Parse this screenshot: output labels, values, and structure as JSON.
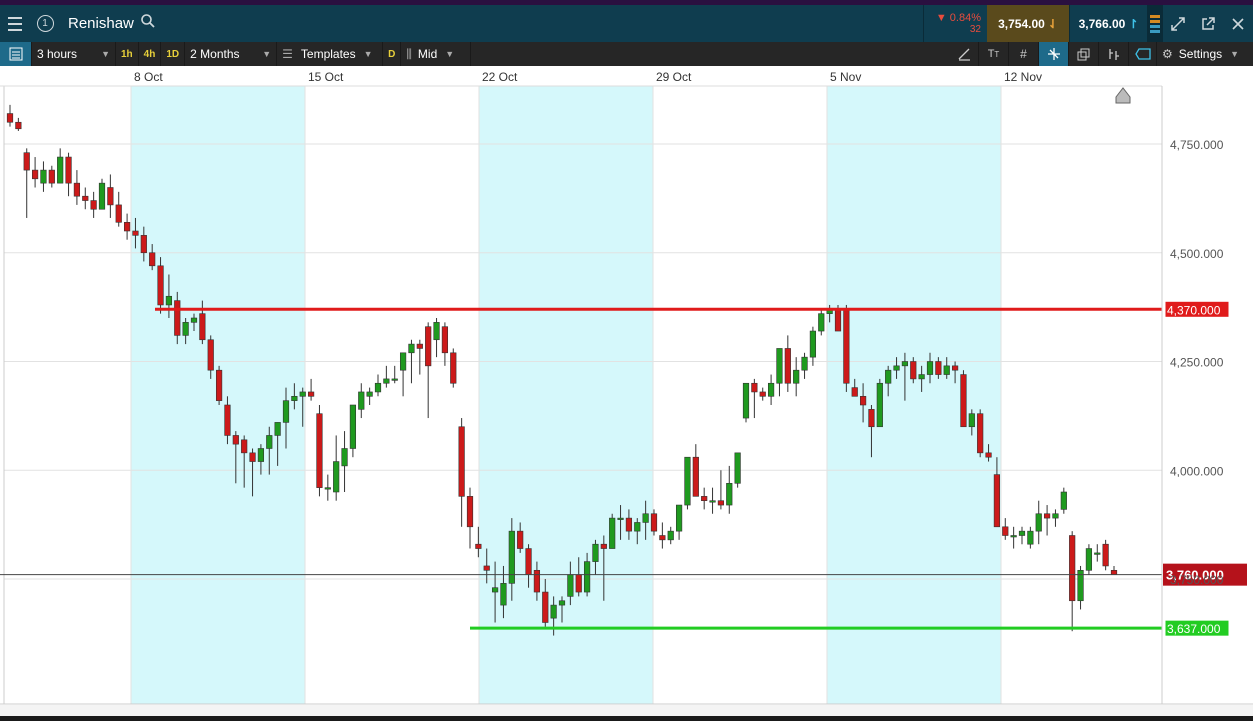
{
  "header": {
    "menu_icon": "hamburger-icon",
    "window_number": "1",
    "title": "Renishaw",
    "change_pct": "0.84%",
    "change_points": "32",
    "sell_price": "3,754.00",
    "buy_price": "3,766.00"
  },
  "toolbar": {
    "interval": "3 hours",
    "tf_1h": "1h",
    "tf_4h": "4h",
    "tf_1d": "1D",
    "range": "2 Months",
    "templates": "Templates",
    "d_badge": "D",
    "price_type": "Mid",
    "settings": "Settings"
  },
  "colors": {
    "up": "#1f9a1f",
    "down": "#cc1a1a",
    "shade": "#d5f8fb",
    "resistance": "#e01b1b",
    "support": "#22cc22"
  },
  "chart_data": {
    "type": "candlestick",
    "x_tick_labels": [
      "8 Oct",
      "15 Oct",
      "22 Oct",
      "29 Oct",
      "5 Nov",
      "12 Nov"
    ],
    "y_tick_labels": [
      "4,750.000",
      "4,500.000",
      "4,250.000",
      "4,000.000",
      "3,750.000"
    ],
    "y_ticks": [
      4750,
      4500,
      4250,
      4000,
      3750
    ],
    "ylim": [
      3500,
      4860
    ],
    "levels": [
      {
        "value": 4370,
        "label": "4,370.000",
        "color": "#e01b1b"
      },
      {
        "value": 3637,
        "label": "3,637.000",
        "color": "#22cc22"
      }
    ],
    "current_price": {
      "value": 3760,
      "label": "3,760.000"
    },
    "candles": [
      [
        4820,
        4840,
        4790,
        4800
      ],
      [
        4800,
        4810,
        4780,
        4785
      ],
      [
        4730,
        4740,
        4580,
        4690
      ],
      [
        4690,
        4720,
        4650,
        4670
      ],
      [
        4660,
        4710,
        4640,
        4690
      ],
      [
        4690,
        4700,
        4650,
        4660
      ],
      [
        4660,
        4740,
        4660,
        4720
      ],
      [
        4720,
        4730,
        4630,
        4660
      ],
      [
        4660,
        4690,
        4610,
        4630
      ],
      [
        4630,
        4650,
        4600,
        4620
      ],
      [
        4620,
        4640,
        4580,
        4600
      ],
      [
        4600,
        4670,
        4600,
        4660
      ],
      [
        4650,
        4680,
        4580,
        4610
      ],
      [
        4610,
        4640,
        4560,
        4570
      ],
      [
        4570,
        4590,
        4530,
        4550
      ],
      [
        4550,
        4580,
        4510,
        4540
      ],
      [
        4540,
        4560,
        4480,
        4500
      ],
      [
        4500,
        4520,
        4460,
        4470
      ],
      [
        4470,
        4490,
        4360,
        4380
      ],
      [
        4380,
        4450,
        4350,
        4400
      ],
      [
        4390,
        4410,
        4290,
        4310
      ],
      [
        4310,
        4350,
        4290,
        4340
      ],
      [
        4340,
        4360,
        4320,
        4350
      ],
      [
        4360,
        4390,
        4290,
        4300
      ],
      [
        4300,
        4310,
        4210,
        4230
      ],
      [
        4230,
        4240,
        4150,
        4160
      ],
      [
        4150,
        4170,
        4060,
        4080
      ],
      [
        4080,
        4090,
        3970,
        4060
      ],
      [
        4070,
        4080,
        3960,
        4040
      ],
      [
        4040,
        4050,
        3940,
        4020
      ],
      [
        4020,
        4060,
        3990,
        4050
      ],
      [
        4050,
        4100,
        3990,
        4080
      ],
      [
        4080,
        4110,
        4010,
        4110
      ],
      [
        4110,
        4190,
        4050,
        4160
      ],
      [
        4160,
        4200,
        4140,
        4170
      ],
      [
        4170,
        4190,
        4100,
        4180
      ],
      [
        4180,
        4210,
        4160,
        4170
      ],
      [
        4130,
        4150,
        3940,
        3960
      ],
      [
        3960,
        3990,
        3930,
        3960
      ],
      [
        3950,
        4080,
        3930,
        4020
      ],
      [
        4010,
        4090,
        3950,
        4050
      ],
      [
        4050,
        4130,
        4030,
        4150
      ],
      [
        4140,
        4200,
        4120,
        4180
      ],
      [
        4170,
        4190,
        4150,
        4180
      ],
      [
        4180,
        4220,
        4170,
        4200
      ],
      [
        4200,
        4240,
        4190,
        4210
      ],
      [
        4210,
        4240,
        4200,
        4210
      ],
      [
        4230,
        4270,
        4170,
        4270
      ],
      [
        4270,
        4300,
        4200,
        4290
      ],
      [
        4290,
        4300,
        4220,
        4280
      ],
      [
        4330,
        4340,
        4120,
        4240
      ],
      [
        4300,
        4350,
        4260,
        4340
      ],
      [
        4330,
        4340,
        4240,
        4270
      ],
      [
        4270,
        4280,
        4190,
        4200
      ],
      [
        4100,
        4120,
        3870,
        3940
      ],
      [
        3940,
        3960,
        3820,
        3870
      ],
      [
        3830,
        3870,
        3800,
        3820
      ],
      [
        3780,
        3820,
        3740,
        3770
      ],
      [
        3720,
        3790,
        3650,
        3730
      ],
      [
        3690,
        3780,
        3660,
        3740
      ],
      [
        3740,
        3890,
        3700,
        3860
      ],
      [
        3860,
        3880,
        3810,
        3820
      ],
      [
        3820,
        3830,
        3730,
        3760
      ],
      [
        3770,
        3790,
        3700,
        3720
      ],
      [
        3720,
        3750,
        3640,
        3650
      ],
      [
        3660,
        3710,
        3620,
        3690
      ],
      [
        3690,
        3710,
        3650,
        3700
      ],
      [
        3710,
        3790,
        3690,
        3760
      ],
      [
        3760,
        3800,
        3710,
        3720
      ],
      [
        3720,
        3810,
        3710,
        3790
      ],
      [
        3790,
        3840,
        3760,
        3830
      ],
      [
        3830,
        3850,
        3700,
        3820
      ],
      [
        3820,
        3900,
        3820,
        3890
      ],
      [
        3890,
        3920,
        3840,
        3890
      ],
      [
        3890,
        3910,
        3840,
        3860
      ],
      [
        3860,
        3890,
        3830,
        3880
      ],
      [
        3880,
        3930,
        3840,
        3900
      ],
      [
        3900,
        3910,
        3850,
        3860
      ],
      [
        3850,
        3880,
        3820,
        3840
      ],
      [
        3840,
        3870,
        3830,
        3860
      ],
      [
        3860,
        3920,
        3840,
        3920
      ],
      [
        3920,
        4020,
        3910,
        4030
      ],
      [
        4030,
        4060,
        3940,
        3940
      ],
      [
        3940,
        3960,
        3910,
        3930
      ],
      [
        3930,
        3960,
        3900,
        3930
      ],
      [
        3930,
        4000,
        3910,
        3920
      ],
      [
        3920,
        4010,
        3900,
        3970
      ],
      [
        3970,
        4030,
        3960,
        4040
      ],
      [
        4120,
        4200,
        4110,
        4200
      ],
      [
        4200,
        4210,
        4120,
        4180
      ],
      [
        4180,
        4190,
        4160,
        4170
      ],
      [
        4170,
        4220,
        4150,
        4200
      ],
      [
        4200,
        4260,
        4170,
        4280
      ],
      [
        4280,
        4310,
        4180,
        4200
      ],
      [
        4200,
        4260,
        4170,
        4230
      ],
      [
        4230,
        4270,
        4210,
        4260
      ],
      [
        4260,
        4330,
        4240,
        4320
      ],
      [
        4320,
        4370,
        4310,
        4360
      ],
      [
        4360,
        4380,
        4340,
        4370
      ],
      [
        4370,
        4380,
        4320,
        4320
      ],
      [
        4370,
        4380,
        4180,
        4200
      ],
      [
        4190,
        4210,
        4170,
        4170
      ],
      [
        4170,
        4200,
        4110,
        4150
      ],
      [
        4140,
        4150,
        4030,
        4100
      ],
      [
        4100,
        4210,
        4100,
        4200
      ],
      [
        4200,
        4240,
        4170,
        4230
      ],
      [
        4230,
        4260,
        4210,
        4240
      ],
      [
        4240,
        4270,
        4160,
        4250
      ],
      [
        4250,
        4260,
        4200,
        4210
      ],
      [
        4210,
        4240,
        4180,
        4220
      ],
      [
        4220,
        4270,
        4200,
        4250
      ],
      [
        4250,
        4260,
        4210,
        4220
      ],
      [
        4220,
        4260,
        4210,
        4240
      ],
      [
        4240,
        4250,
        4200,
        4230
      ],
      [
        4220,
        4230,
        4100,
        4100
      ],
      [
        4100,
        4140,
        4080,
        4130
      ],
      [
        4130,
        4140,
        4030,
        4040
      ],
      [
        4040,
        4060,
        4020,
        4030
      ],
      [
        3990,
        4030,
        3870,
        3870
      ],
      [
        3870,
        3890,
        3840,
        3850
      ],
      [
        3850,
        3870,
        3820,
        3850
      ],
      [
        3850,
        3870,
        3830,
        3860
      ],
      [
        3830,
        3870,
        3820,
        3860
      ],
      [
        3860,
        3930,
        3830,
        3900
      ],
      [
        3900,
        3920,
        3850,
        3890
      ],
      [
        3890,
        3910,
        3870,
        3900
      ],
      [
        3910,
        3960,
        3900,
        3950
      ],
      [
        3850,
        3860,
        3630,
        3700
      ],
      [
        3700,
        3780,
        3680,
        3770
      ],
      [
        3770,
        3830,
        3760,
        3820
      ],
      [
        3810,
        3830,
        3790,
        3810
      ],
      [
        3830,
        3840,
        3770,
        3780
      ],
      [
        3770,
        3780,
        3760,
        3760
      ]
    ]
  }
}
